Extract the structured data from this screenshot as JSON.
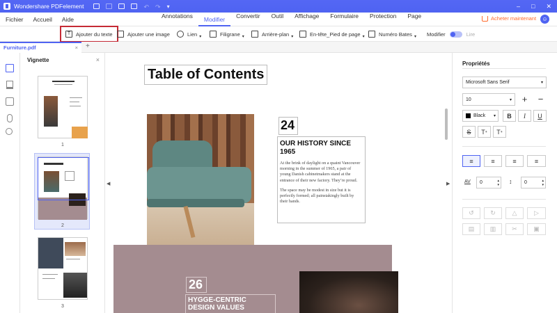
{
  "app": {
    "title": "Wondershare PDFelement"
  },
  "menu": {
    "left": [
      "Fichier",
      "Accueil",
      "Aide"
    ],
    "center": [
      "Annotations",
      "Modifier",
      "Convertir",
      "Outil",
      "Affichage",
      "Formulaire",
      "Protection",
      "Page"
    ],
    "active": "Modifier",
    "buy": "Acheter maintenant",
    "user": "☺"
  },
  "toolbar": {
    "add_text": "Ajouter du texte",
    "add_image": "Ajouter une image",
    "link": "Lien",
    "watermark": "Filigrane",
    "background": "Arrière-plan",
    "header_footer": "En-tête_Pied de page",
    "bates": "Numéro Bates",
    "edit": "Modifier",
    "read": "Lire"
  },
  "tabs": {
    "file": "Furniture.pdf"
  },
  "thumbnails": {
    "title": "Vignette",
    "pages": [
      "1",
      "2",
      "3"
    ]
  },
  "page": {
    "toc": "Table of Contents",
    "n24": "24",
    "history_title": "OUR HISTORY SINCE 1965",
    "history_p1": "At the brink of daylight on a quaint Vancouver morning in the summer of 1965, a pair of young Danish cabinetmakers stand at the entrance of their new factory. They’re proud.",
    "history_p2": "The space may be modest in size but it is perfectly formed; all painstakingly built by their hands.",
    "n26": "26",
    "hygge": "HYGGE-CENTRIC DESIGN VALUES"
  },
  "props": {
    "title": "Propriétés",
    "font": "Microsoft Sans Serif",
    "size": "10",
    "color": "Black",
    "char_spacing": "0",
    "line_spacing": "0"
  },
  "colors": {
    "accent": "#4f63f2",
    "highlight": "#c52a35",
    "buy": "#ff6a2c"
  }
}
